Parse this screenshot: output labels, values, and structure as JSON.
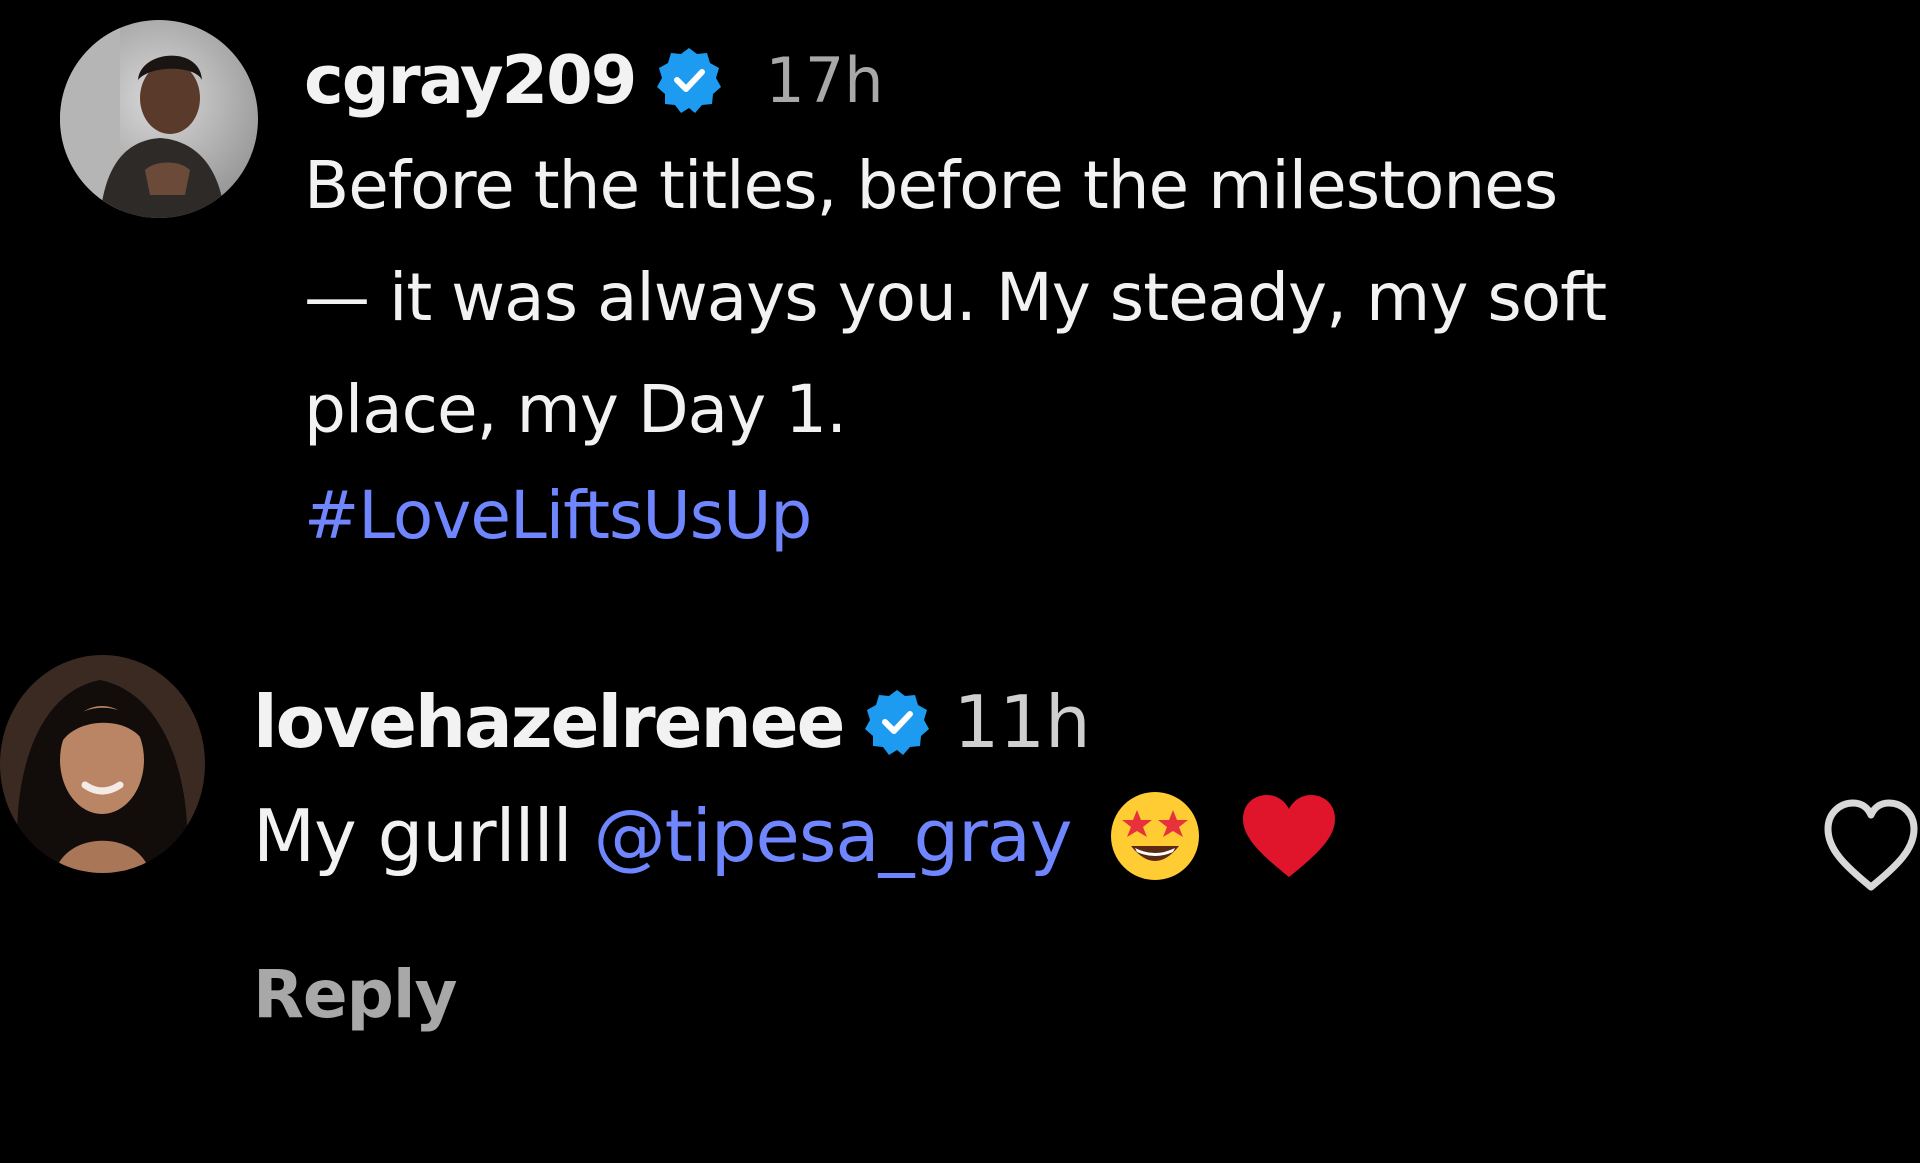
{
  "post": {
    "username": "cgray209",
    "time": "17h",
    "caption_lines": [
      "Before the titles, before the milestones",
      "— it was always you. My steady, my soft",
      "place, my Day 1."
    ],
    "hashtag": "#LoveLiftsUsUp",
    "verified": true
  },
  "reply_comment": {
    "username": "lovehazelrenee",
    "time": "11h",
    "text": "My gurllll",
    "mention": "@tipesa_gray",
    "emojis": [
      "star-struck-emoji",
      "red-heart-emoji"
    ],
    "reply_label": "Reply",
    "verified": true
  },
  "colors": {
    "background": "#000000",
    "text": "#f2f2f2",
    "muted": "#a8a8a8",
    "link": "#6f86ff",
    "verified": "#1d9bf0",
    "heart": "#e0142b"
  },
  "icons": {
    "verified": "verified-badge-icon",
    "like": "heart-outline-icon"
  }
}
